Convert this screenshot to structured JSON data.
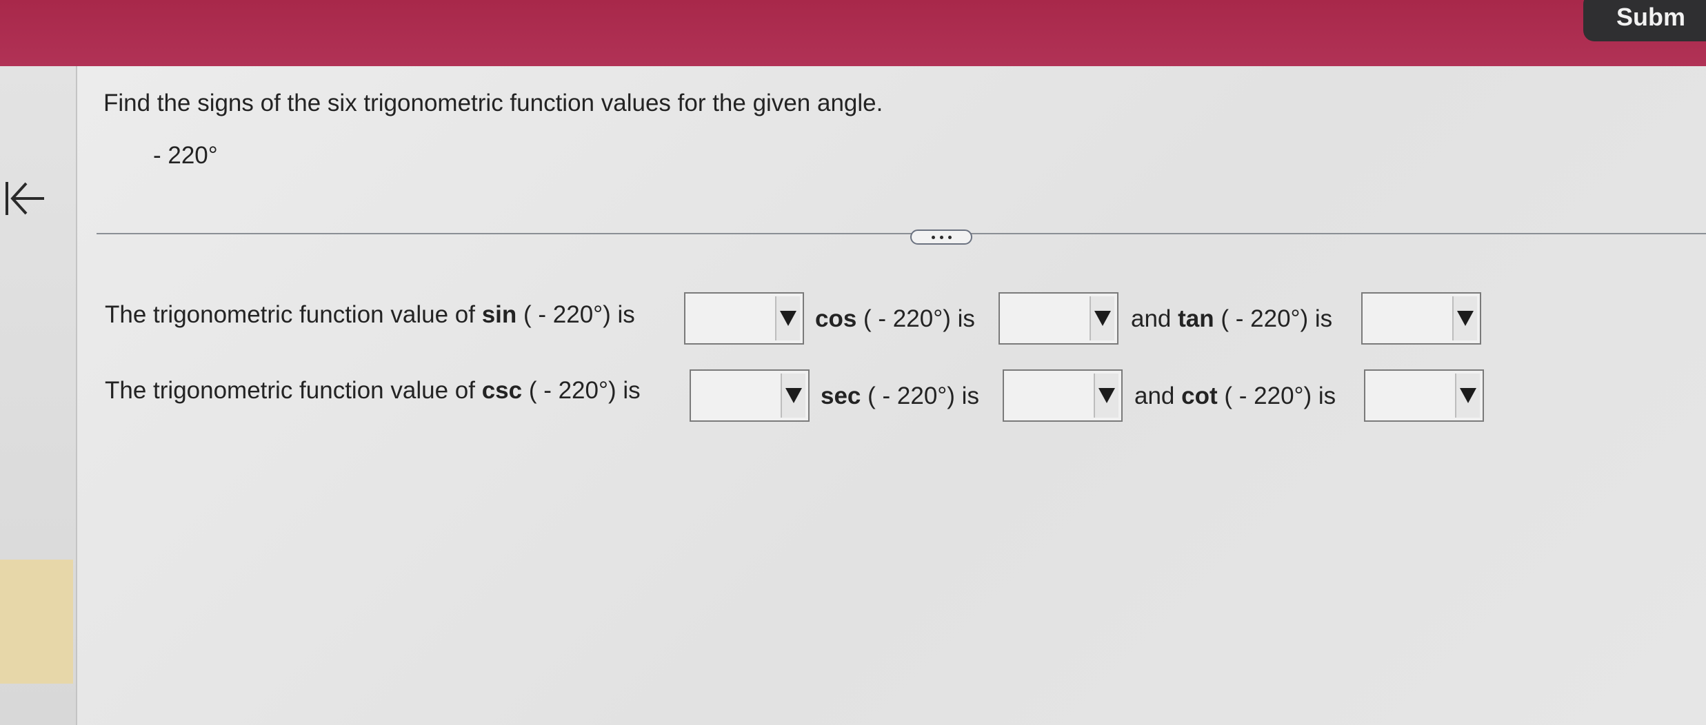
{
  "header": {
    "submit_label": "Subm"
  },
  "icons": {
    "back": "back-to-start-icon",
    "more": "ellipsis-icon",
    "dropdown": "dropdown-arrow-icon"
  },
  "question": {
    "prompt": "Find the signs of the six trigonometric function values for the given angle.",
    "angle": "- 220°"
  },
  "row1": {
    "lead": "The trigonometric function value of",
    "sin_fn": "sin",
    "sin_arg": "( - 220°) is",
    "cos_fn": "cos",
    "cos_arg": "( - 220°) is",
    "and1": "and",
    "tan_fn": "tan",
    "tan_arg": "( - 220°) is"
  },
  "row2": {
    "lead": "The trigonometric function value of",
    "csc_fn": "csc",
    "csc_arg": "( - 220°) is",
    "sec_fn": "sec",
    "sec_arg": "( - 220°) is",
    "and2": "and",
    "cot_fn": "cot",
    "cot_arg": "( - 220°) is"
  },
  "answers": {
    "sin": "",
    "cos": "",
    "tan": "",
    "csc": "",
    "sec": "",
    "cot": ""
  }
}
